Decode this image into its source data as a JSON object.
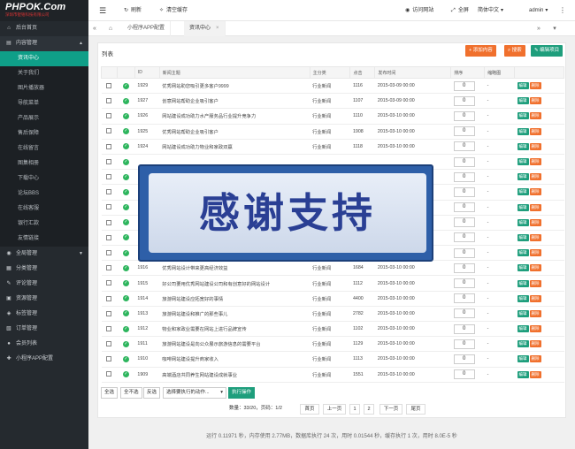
{
  "logo": {
    "main": "PHPOK.Com",
    "sub": "深圳市锟铻科技有限公司"
  },
  "sidebar": {
    "home": "后台首页",
    "content_group": "内容管理",
    "content_items": [
      "资讯中心",
      "关于我们",
      "图片播放器",
      "导航菜单",
      "产品展示",
      "售后保障",
      "在线留言",
      "图集相册",
      "下载中心",
      "论坛BBS",
      "在线客服",
      "银行汇款",
      "友情链接"
    ],
    "groups": [
      "全局管理",
      "分类管理",
      "评论管理",
      "资源管理",
      "标签管理",
      "订单管理",
      "会员列表",
      "小程序APP配置"
    ]
  },
  "topbar": {
    "refresh": "刷新",
    "clear_cache": "清空缓存",
    "visit_site": "访问网站",
    "fullscreen": "全屏",
    "language": "简体中文",
    "user": "admin"
  },
  "tabs": [
    "小程序APP配置",
    "资讯中心"
  ],
  "panel": {
    "title": "列表",
    "add": "添加内容",
    "search": "搜索",
    "edit_project": "编辑项目"
  },
  "table": {
    "headers": [
      "",
      "",
      "ID",
      "新闻主题",
      "主分类",
      "点击",
      "发布时间",
      "排序",
      "缩略图",
      ""
    ],
    "rows": [
      {
        "id": "1929",
        "title": "优秀网站助您吸引更多客户9999",
        "cat": "行业新闻",
        "hits": "1116",
        "date": "2015-03-09 00:00",
        "sort": "0",
        "thumb": "-"
      },
      {
        "id": "1927",
        "title": "创意网站帮助企业吸引客户",
        "cat": "行业新闻",
        "hits": "1107",
        "date": "2015-03-09 00:00",
        "sort": "0",
        "thumb": "-"
      },
      {
        "id": "1926",
        "title": "网站建设成功助力水产服务品行业提升竞争力",
        "cat": "行业新闻",
        "hits": "1110",
        "date": "2015-03-10 00:00",
        "sort": "0",
        "thumb": "-"
      },
      {
        "id": "1925",
        "title": "优秀网站帮助企业吸引客户",
        "cat": "行业新闻",
        "hits": "1908",
        "date": "2015-03-10 00:00",
        "sort": "0",
        "thumb": "-"
      },
      {
        "id": "1924",
        "title": "网站建设成功助力物业和家政双赢",
        "cat": "行业新闻",
        "hits": "1118",
        "date": "2015-03-10 00:00",
        "sort": "0",
        "thumb": "-"
      },
      {
        "id": "",
        "title": "",
        "cat": "",
        "hits": "",
        "date": "",
        "sort": "0",
        "thumb": "-"
      },
      {
        "id": "",
        "title": "",
        "cat": "",
        "hits": "",
        "date": "",
        "sort": "0",
        "thumb": "-"
      },
      {
        "id": "",
        "title": "",
        "cat": "",
        "hits": "",
        "date": "",
        "sort": "0",
        "thumb": "-"
      },
      {
        "id": "",
        "title": "",
        "cat": "",
        "hits": "",
        "date": "",
        "sort": "0",
        "thumb": "-"
      },
      {
        "id": "",
        "title": "",
        "cat": "",
        "hits": "",
        "date": "",
        "sort": "0",
        "thumb": "-"
      },
      {
        "id": "",
        "title": "",
        "cat": "",
        "hits": "",
        "date": "",
        "sort": "0",
        "thumb": "-"
      },
      {
        "id": "",
        "title": "",
        "cat": "",
        "hits": "",
        "date": "",
        "sort": "0",
        "thumb": "-"
      },
      {
        "id": "1916",
        "title": "优秀网站设计带来更高经济效益",
        "cat": "行业新闻",
        "hits": "1684",
        "date": "2015-03-10 00:00",
        "sort": "0",
        "thumb": "-"
      },
      {
        "id": "1915",
        "title": "好公司要用优秀网站建设公司和有创意好的网站设计",
        "cat": "行业新闻",
        "hits": "1112",
        "date": "2015-03-10 00:00",
        "sort": "0",
        "thumb": "-"
      },
      {
        "id": "1914",
        "title": "旅游网站建设应拓宽好的事情",
        "cat": "行业新闻",
        "hits": "4400",
        "date": "2015-03-10 00:00",
        "sort": "0",
        "thumb": "-"
      },
      {
        "id": "1913",
        "title": "旅游网站建设和推广的那些事儿",
        "cat": "行业新闻",
        "hits": "2782",
        "date": "2015-03-10 00:00",
        "sort": "0",
        "thumb": "-"
      },
      {
        "id": "1912",
        "title": "物业和家政业需要在网站上进行品牌宣传",
        "cat": "行业新闻",
        "hits": "1102",
        "date": "2015-03-10 00:00",
        "sort": "0",
        "thumb": "-"
      },
      {
        "id": "1911",
        "title": "旅游网站建设是向公众展示旅游信息的需要平台",
        "cat": "行业新闻",
        "hits": "1129",
        "date": "2015-03-10 00:00",
        "sort": "0",
        "thumb": "-"
      },
      {
        "id": "1910",
        "title": "咖啡网站建设提升商家收入",
        "cat": "行业新闻",
        "hits": "1113",
        "date": "2015-03-10 00:00",
        "sort": "0",
        "thumb": "-"
      },
      {
        "id": "1909",
        "title": "高端酒店共同养生网站建设成就事业",
        "cat": "行业新闻",
        "hits": "1551",
        "date": "2015-03-10 00:00",
        "sort": "0",
        "thumb": "-"
      }
    ],
    "row_edit": "编辑",
    "row_delete": "删除"
  },
  "actions": {
    "select_all": "全选",
    "select_none": "全不选",
    "invert": "反选",
    "batch_select": "选择要执行的动作...",
    "execute": "执行操作"
  },
  "pager": {
    "info": "数量：33/20，页码：1/2",
    "home": "首页",
    "prev": "上一页",
    "p1": "1",
    "p2": "2",
    "next": "下一页",
    "last": "尾页"
  },
  "footer": "运行 0.11971 秒，内存使用 2.77MB，数据库执行 24 次，用时 0.01544 秒，缓存执行 1 次，用时 8.0E-5 秒",
  "overlay": {
    "text": "感谢支持"
  },
  "colors": {
    "accent": "#0f9f88",
    "orange": "#f0702d",
    "sidebar": "#252a2f"
  }
}
